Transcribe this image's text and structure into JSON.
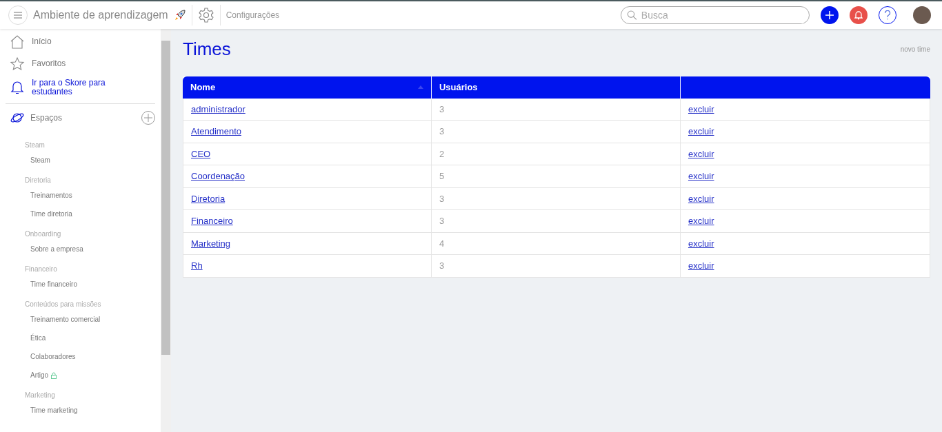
{
  "header": {
    "title": "Ambiente de aprendizagem",
    "section": "Configurações",
    "search": {
      "placeholder": "Busca"
    }
  },
  "sidebar": {
    "nav": [
      {
        "label": "Início",
        "highlight": false
      },
      {
        "label": "Favoritos",
        "highlight": false
      },
      {
        "label": "Ir para o Skore para estudantes",
        "highlight": true
      }
    ],
    "spaces_label": "Espaços",
    "groups": [
      {
        "title": "Steam",
        "items": [
          {
            "label": "Steam",
            "locked": false
          }
        ]
      },
      {
        "title": "Diretoria",
        "items": [
          {
            "label": "Treinamentos",
            "locked": false
          },
          {
            "label": "Time diretoria",
            "locked": false
          }
        ]
      },
      {
        "title": "Onboarding",
        "items": [
          {
            "label": "Sobre a empresa",
            "locked": false
          }
        ]
      },
      {
        "title": "Financeiro",
        "items": [
          {
            "label": "Time financeiro",
            "locked": false
          }
        ]
      },
      {
        "title": "Conteúdos para missões",
        "items": [
          {
            "label": "Treinamento comercial",
            "locked": false
          },
          {
            "label": "Ética",
            "locked": false
          },
          {
            "label": "Colaboradores",
            "locked": false
          },
          {
            "label": "Artigo",
            "locked": true
          }
        ]
      },
      {
        "title": "Marketing",
        "items": [
          {
            "label": "Time marketing",
            "locked": false
          }
        ]
      }
    ]
  },
  "page": {
    "title": "Times",
    "new_link": "novo time"
  },
  "table": {
    "columns": [
      "Nome",
      "Usuários"
    ],
    "rows": [
      {
        "name": "administrador",
        "users": "3",
        "action": "excluir"
      },
      {
        "name": "Atendimento",
        "users": "3",
        "action": "excluir"
      },
      {
        "name": "CEO",
        "users": "2",
        "action": "excluir"
      },
      {
        "name": "Coordenação",
        "users": "5",
        "action": "excluir"
      },
      {
        "name": "Diretoria",
        "users": "3",
        "action": "excluir"
      },
      {
        "name": "Financeiro",
        "users": "3",
        "action": "excluir"
      },
      {
        "name": "Marketing",
        "users": "4",
        "action": "excluir"
      },
      {
        "name": "Rh",
        "users": "3",
        "action": "excluir"
      }
    ]
  }
}
